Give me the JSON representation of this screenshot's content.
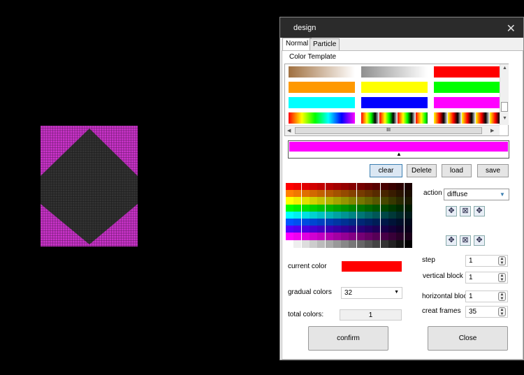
{
  "window": {
    "title": "design",
    "close_symbol": "✕"
  },
  "tabs": [
    {
      "label": "Normal",
      "active": true
    },
    {
      "label": "Particle",
      "active": false
    }
  ],
  "color_template": {
    "label": "Color Template",
    "rows": [
      [
        "linear-gradient(90deg,#a07040,#ffffff)",
        "linear-gradient(90deg,#909090,#ffffff)",
        "#ff0000"
      ],
      [
        "#ff9900",
        "#ffff00",
        "#00ff00"
      ],
      [
        "#00ffff",
        "#0000ff",
        "#ff00ff"
      ],
      [
        "linear-gradient(90deg,#ff0000,#ffff00,#00ff00,#00ffff,#0000ff,#ff00ff)",
        "repeating-linear-gradient(90deg,#ff0000 0,#ffff00 8px,#00ff00 14px,#000000 20px,#ffffff 26px)",
        "repeating-linear-gradient(90deg,#ffff00 0,#ff0000 8px,#000000 14px,#ffffff 20px)"
      ]
    ],
    "hscroll_grip": "III",
    "scroll_up": "▲",
    "scroll_down": "▼",
    "scroll_left": "◀",
    "scroll_right": "▶"
  },
  "gradient": {
    "color": "#ff00ff",
    "marker": "▲"
  },
  "buttons": {
    "clear": "clear",
    "delete": "Delete",
    "load": "load",
    "save": "save",
    "confirm": "confirm",
    "close": "Close"
  },
  "action": {
    "label": "action",
    "value": "diffuse",
    "dropdown_icon": "chevron-down-icon"
  },
  "direction_icons": {
    "move": "✥",
    "shrink": "⊠"
  },
  "current_color": {
    "label": "current color",
    "value": "#ff0000"
  },
  "gradual_colors": {
    "label": "gradual colors",
    "value": "32"
  },
  "total_colors": {
    "label": "total colors:",
    "value": "1"
  },
  "step": {
    "label": "step",
    "value": "1"
  },
  "vertical_block": {
    "label": "vertical block",
    "value": "1"
  },
  "horizontal_block": {
    "label": "horizontal bloc",
    "value": "1"
  },
  "creat_frames": {
    "label": "creat frames",
    "value": "35"
  },
  "spin_up": "▲",
  "spin_down": "▼",
  "select_arrow": "▼",
  "led_preview": {
    "shape_color": "#333333",
    "background_color": "#cc33cc"
  }
}
